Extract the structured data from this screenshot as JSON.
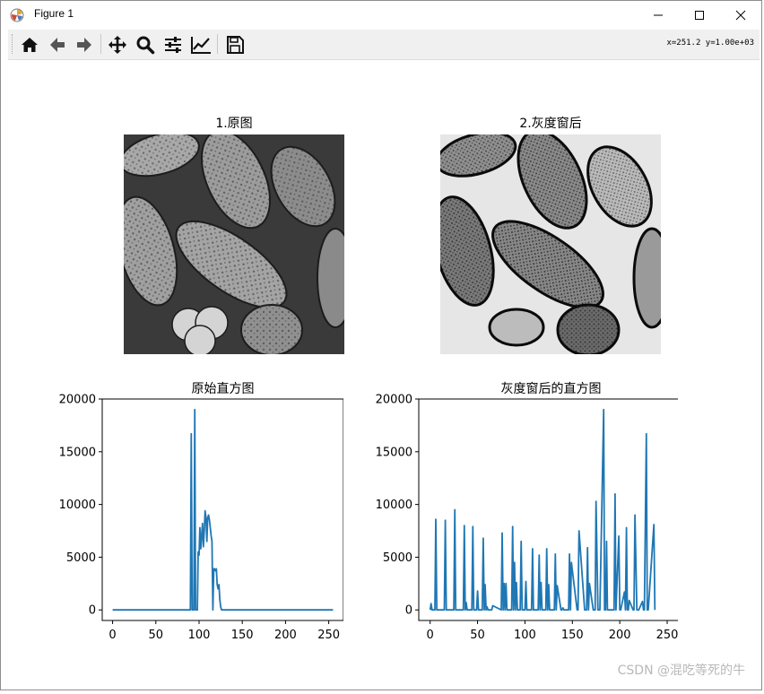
{
  "window": {
    "title": "Figure 1",
    "minimize_label": "—",
    "maximize_label": "☐",
    "close_label": "✕"
  },
  "toolbar": {
    "coords": "x=251.2 y=1.00e+03",
    "buttons": [
      "home-icon",
      "back-icon",
      "forward-icon",
      "pan-icon",
      "zoom-icon",
      "configure-subplots-icon",
      "edit-axis-icon",
      "save-icon"
    ]
  },
  "figure": {
    "subplot1_title": "1.原图",
    "subplot2_title": "2.灰度窗后",
    "watermark": "CSDN @混吃等死的牛"
  },
  "chart_data": [
    {
      "type": "line",
      "title": "原始直方图",
      "xlim": [
        -12,
        267
      ],
      "ylim": [
        -1000,
        20000
      ],
      "xticks": [
        0,
        50,
        100,
        150,
        200,
        250
      ],
      "xtick_labels": [
        "0",
        "50",
        "100",
        "150",
        "200",
        "250"
      ],
      "yticks": [
        0,
        5000,
        10000,
        15000,
        20000
      ],
      "ytick_labels": [
        "0",
        "5000",
        "10000",
        "15000",
        "20000"
      ],
      "color": "#1f77b4",
      "x": [
        0,
        90,
        91,
        92,
        94,
        95,
        96,
        98,
        99,
        100,
        101,
        102,
        104,
        105,
        106,
        107,
        108,
        109,
        110,
        111,
        112,
        113,
        114,
        115,
        116,
        117,
        118,
        119,
        120,
        121,
        122,
        123,
        124,
        125,
        126,
        127,
        128,
        129,
        130,
        131,
        132,
        133,
        134,
        135,
        136,
        138,
        255
      ],
      "y": [
        0,
        0,
        16700,
        0,
        0,
        19000,
        0,
        0,
        5500,
        5200,
        7800,
        5800,
        8200,
        6000,
        7500,
        9400,
        8800,
        6500,
        8700,
        9000,
        8500,
        7800,
        7000,
        6500,
        0,
        3900,
        3900,
        3700,
        3900,
        2400,
        2000,
        2400,
        1000,
        300,
        0,
        0,
        0,
        0,
        0,
        0,
        0,
        0,
        0,
        0,
        0,
        0,
        0
      ]
    },
    {
      "type": "line",
      "title": "灰度窗后的直方图",
      "xlim": [
        -12,
        267
      ],
      "ylim": [
        -1000,
        20000
      ],
      "xticks": [
        0,
        50,
        100,
        150,
        200,
        250
      ],
      "xtick_labels": [
        "0",
        "50",
        "100",
        "150",
        "200",
        "250"
      ],
      "yticks": [
        0,
        5000,
        10000,
        15000,
        20000
      ],
      "ytick_labels": [
        "0",
        "5000",
        "10000",
        "15000",
        "20000"
      ],
      "color": "#1f77b4",
      "x": [
        0,
        1,
        2,
        5,
        6,
        7,
        8,
        15,
        16,
        17,
        25,
        26,
        27,
        35,
        36,
        37,
        38,
        39,
        44,
        45,
        46,
        49,
        50,
        51,
        55,
        56,
        57,
        58,
        59,
        60,
        61,
        65,
        66,
        75,
        76,
        77,
        78,
        79,
        80,
        81,
        86,
        87,
        88,
        89,
        90,
        91,
        92,
        95,
        96,
        97,
        100,
        101,
        102,
        103,
        107,
        108,
        109,
        110,
        114,
        115,
        116,
        117,
        118,
        122,
        123,
        124,
        125,
        126,
        131,
        132,
        133,
        134,
        138,
        139,
        140,
        141,
        145,
        146,
        147,
        148,
        149,
        155,
        156,
        157,
        163,
        164,
        165,
        166,
        167,
        168,
        172,
        173,
        174,
        175,
        177,
        178,
        179,
        183,
        184,
        185,
        186,
        187,
        193,
        194,
        195,
        196,
        199,
        200,
        201,
        205,
        206,
        207,
        208,
        209,
        210,
        214,
        215,
        216,
        218,
        219,
        220,
        224,
        225,
        226,
        228,
        229,
        230,
        236,
        237,
        238,
        239,
        240,
        244,
        245,
        246,
        248,
        249,
        250,
        252,
        253,
        255
      ],
      "y": [
        0,
        600,
        0,
        0,
        8600,
        0,
        0,
        0,
        8500,
        0,
        0,
        9500,
        0,
        0,
        8000,
        0,
        700,
        0,
        0,
        7900,
        0,
        0,
        1800,
        0,
        0,
        6800,
        0,
        2400,
        0,
        300,
        0,
        0,
        400,
        0,
        7300,
        0,
        2500,
        0,
        2500,
        0,
        0,
        7900,
        0,
        4500,
        0,
        2600,
        0,
        0,
        6500,
        0,
        0,
        2700,
        0,
        0,
        0,
        5800,
        0,
        0,
        0,
        5200,
        0,
        2600,
        0,
        0,
        5800,
        0,
        2400,
        0,
        0,
        5300,
        0,
        2300,
        0,
        0,
        200,
        0,
        0,
        0,
        5300,
        0,
        4500,
        0,
        0,
        7500,
        0,
        0,
        0,
        5900,
        0,
        2500,
        0,
        0,
        0,
        10300,
        0,
        0,
        0,
        19000,
        0,
        0,
        6500,
        0,
        0,
        0,
        11000,
        0,
        7000,
        0,
        0,
        1700,
        0,
        7800,
        0,
        0,
        900,
        0,
        0,
        9000,
        0,
        0,
        0,
        800,
        0,
        0,
        16700,
        0,
        0,
        8100,
        0
      ]
    }
  ]
}
